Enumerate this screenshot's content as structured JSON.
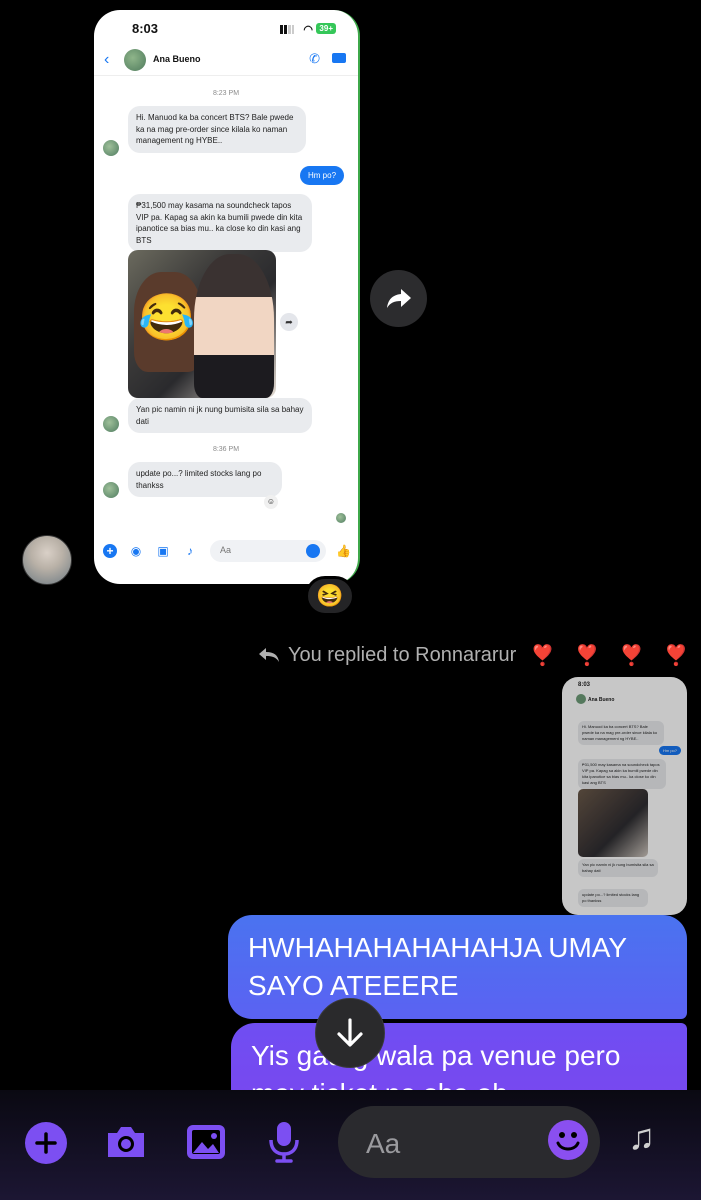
{
  "shared_screenshot": {
    "status_time": "8:03",
    "battery": "39+",
    "contact_name": "Ana Bueno",
    "timestamp_1": "8:23 PM",
    "msg_1": "Hi. Manuod ka ba concert BTS? Bale pwede ka na mag pre-order since kilala ko naman management ng HYBE..",
    "reply_1": "Hm po?",
    "msg_2": "₱31,500 may kasama na soundcheck tapos VIP pa. Kapag sa akin ka bumili pwede din kita ipanotice sa bias mu.. ka close ko din kasi ang BTS",
    "photo_emoji": "😂",
    "msg_3": "Yan pic namin ni jk nung bumisita sila sa bahay dati",
    "timestamp_2": "8:36 PM",
    "msg_4": "update po...? limited stocks lang po thankss",
    "composer_placeholder": "Aa"
  },
  "message_reaction": "😆",
  "reply_header": {
    "text": "You replied to Ronnararur",
    "hearts": [
      "❣️",
      "❣️",
      "❣️",
      "❣️"
    ]
  },
  "mini_screenshot": {
    "status_time": "8:03",
    "contact_name": "Ana Bueno",
    "msg_1": "Hi. Manuod ka ba concert BTS? Bale pwede ka na mag pre-order since kilala ko naman management ng HYBE..",
    "reply_1": "Hm po?",
    "msg_2": "₱31,500 may kasama na soundcheck tapos VIP pa. Kapag sa akin ka bumili pwede din kita ipanotice sa bias mu.. ka close ko din kasi ang BTS",
    "msg_3": "Yan pic namin ni jk nung bumisita sila sa bahay dati",
    "timestamp_2": "8:36 PM",
    "msg_4": "update po...? limited stocks lang po thankss"
  },
  "outgoing_messages": [
    "HWHAHAHAHAHAHJA UMAY SAYO ATEEERE",
    "Yis gaurg wala pa venue pero may ticket na sha oh"
  ],
  "composer": {
    "placeholder": "Aa",
    "icons": [
      "plus-icon",
      "camera-icon",
      "gallery-icon",
      "microphone-icon",
      "emoji-icon",
      "music-notes-icon"
    ]
  },
  "colors": {
    "accent_blue": "#1877f2",
    "bubble_blue": "#4a73f0",
    "bubble_purple": "#7b46ef",
    "composer_icon": "#7c4ff2",
    "heart_red": "#e0242f"
  }
}
